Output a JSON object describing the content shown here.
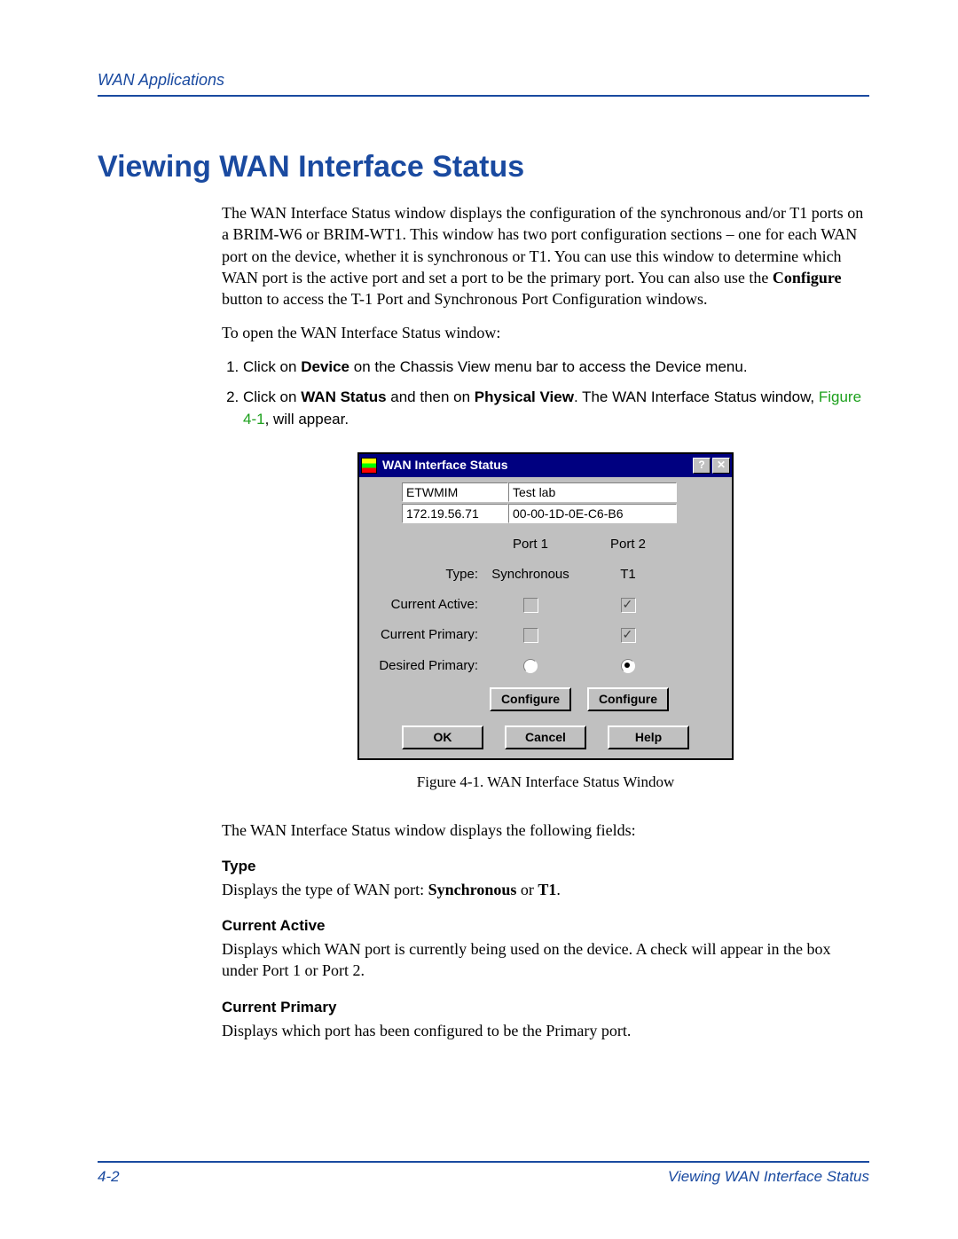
{
  "header": {
    "running": "WAN Applications"
  },
  "title": "Viewing WAN Interface Status",
  "intro": {
    "p1a": "The WAN Interface Status window displays the configuration of the synchronous and/or T1 ports on a BRIM-W6 or BRIM-WT1. This window has two port configuration sections – one for each WAN port on the device, whether it is synchronous or T1. You can use this window to determine which WAN port is the active port and set a port to be the primary port. You can also use the ",
    "p1b": "Configure",
    "p1c": " button to access the T-1 Port and Synchronous Port Configuration windows.",
    "p2": "To open the WAN Interface Status window:"
  },
  "steps": {
    "s1a": "Click on ",
    "s1b": "Device",
    "s1c": " on the Chassis View menu bar to access the Device menu.",
    "s2a": "Click on ",
    "s2b": "WAN Status",
    "s2c": " and then on ",
    "s2d": "Physical View",
    "s2e": ". The WAN Interface Status window, ",
    "s2f": "Figure 4-1",
    "s2g": ", will appear."
  },
  "window": {
    "title": "WAN Interface Status",
    "help_btn": "?",
    "close_btn": "✕",
    "info": {
      "name": "ETWMIM",
      "loc": "Test lab",
      "ip": "172.19.56.71",
      "mac": "00-00-1D-0E-C6-B6"
    },
    "cols": {
      "c1": "Port 1",
      "c2": "Port 2"
    },
    "rows": {
      "type": "Type:",
      "type1": "Synchronous",
      "type2": "T1",
      "ca": "Current Active:",
      "cp": "Current Primary:",
      "dp": "Desired Primary:"
    },
    "buttons": {
      "cfg": "Configure",
      "ok": "OK",
      "cancel": "Cancel",
      "help": "Help"
    }
  },
  "caption": "Figure 4-1. WAN Interface Status Window",
  "after": "The WAN Interface Status window displays the following fields:",
  "fields": {
    "f1h": "Type",
    "f1a": "Displays the type of WAN port: ",
    "f1b": "Synchronous",
    "f1c": " or ",
    "f1d": "T1",
    "f1e": ".",
    "f2h": "Current Active",
    "f2": "Displays which WAN port is currently being used on the device. A check will appear in the box under Port 1 or Port 2.",
    "f3h": "Current Primary",
    "f3": "Displays which port has been configured to be the Primary port."
  },
  "footer": {
    "page": "4-2",
    "section": "Viewing WAN Interface Status"
  }
}
